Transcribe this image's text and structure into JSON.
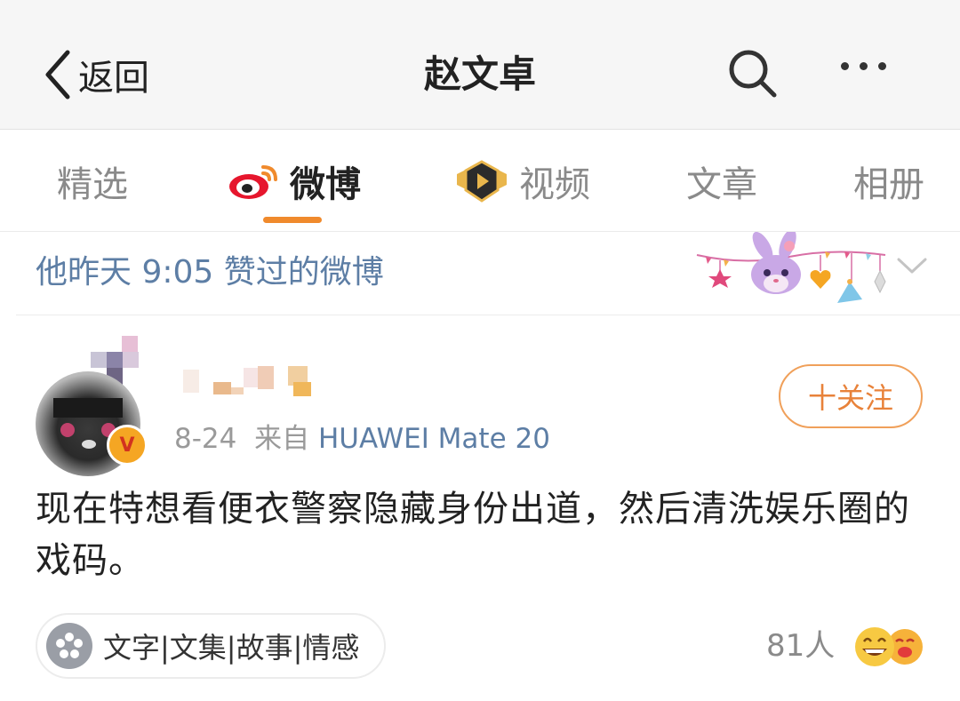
{
  "nav": {
    "back_label": "返回",
    "title": "赵文卓",
    "search_icon": "search-icon",
    "more_icon": "more-icon"
  },
  "tabs": [
    {
      "label": "精选",
      "active": false
    },
    {
      "label": "微博",
      "active": true,
      "icon": "weibo-logo-icon"
    },
    {
      "label": "视频",
      "active": false,
      "icon": "video-badge-icon"
    },
    {
      "label": "文章",
      "active": false
    },
    {
      "label": "相册",
      "active": false
    }
  ],
  "liked_banner": {
    "text": "他昨天 9:05 赞过的微博"
  },
  "post": {
    "date": "8-24",
    "source_prefix": "来自",
    "source": "HUAWEI Mate 20",
    "follow_label": "十关注",
    "content": "现在特想看便衣警察隐藏身份出道，然后清洗娱乐圈的戏码。",
    "topic_label": "文字|文集|故事|情感",
    "likes_count": "81人"
  },
  "colors": {
    "accent_orange": "#f08a2c",
    "link_blue": "#5d7ea5",
    "follow_orange": "#e8823a"
  }
}
